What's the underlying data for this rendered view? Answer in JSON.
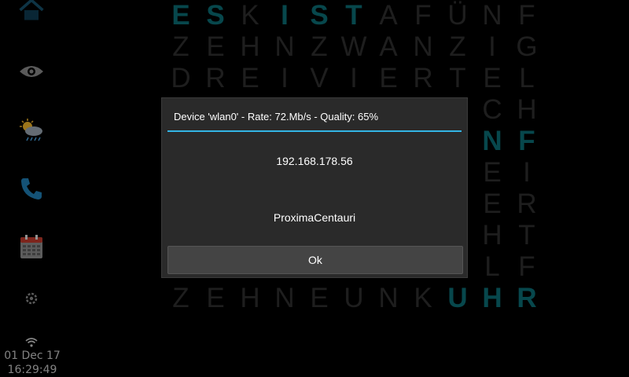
{
  "clock": {
    "date": "01 Dec 17",
    "time": "16:29:49"
  },
  "sidebar": {
    "icons": [
      "home-icon",
      "eye-icon",
      "weather-icon",
      "phone-icon",
      "calendar-icon",
      "settings-icon",
      "wifi-icon"
    ]
  },
  "word_grid": {
    "rows": [
      "ESKISTAFÜNF",
      "ZEHNZWANZIG",
      "DREIVIERTEL",
      "",
      "",
      "",
      "",
      "",
      "",
      "ZEHNEUNKUHR"
    ],
    "partial_right": [
      {
        "row": 3,
        "letters": "CH"
      },
      {
        "row": 4,
        "letters": "NF"
      },
      {
        "row": 5,
        "letters": "EI"
      },
      {
        "row": 6,
        "letters": "ER"
      },
      {
        "row": 7,
        "letters": "HT"
      },
      {
        "row": 8,
        "letters": "LF"
      }
    ],
    "highlighted": [
      "ES",
      "IST",
      "NF",
      "UHR"
    ],
    "active_color": "#0b6e76",
    "inactive_color": "#2f2f2f"
  },
  "dialog": {
    "title": "Device 'wlan0' - Rate: 72.Mb/s - Quality: 65%",
    "ip": "192.168.178.56",
    "ssid": "ProximaCentauri",
    "ok_label": "Ok",
    "accent_color": "#33b5e5"
  }
}
